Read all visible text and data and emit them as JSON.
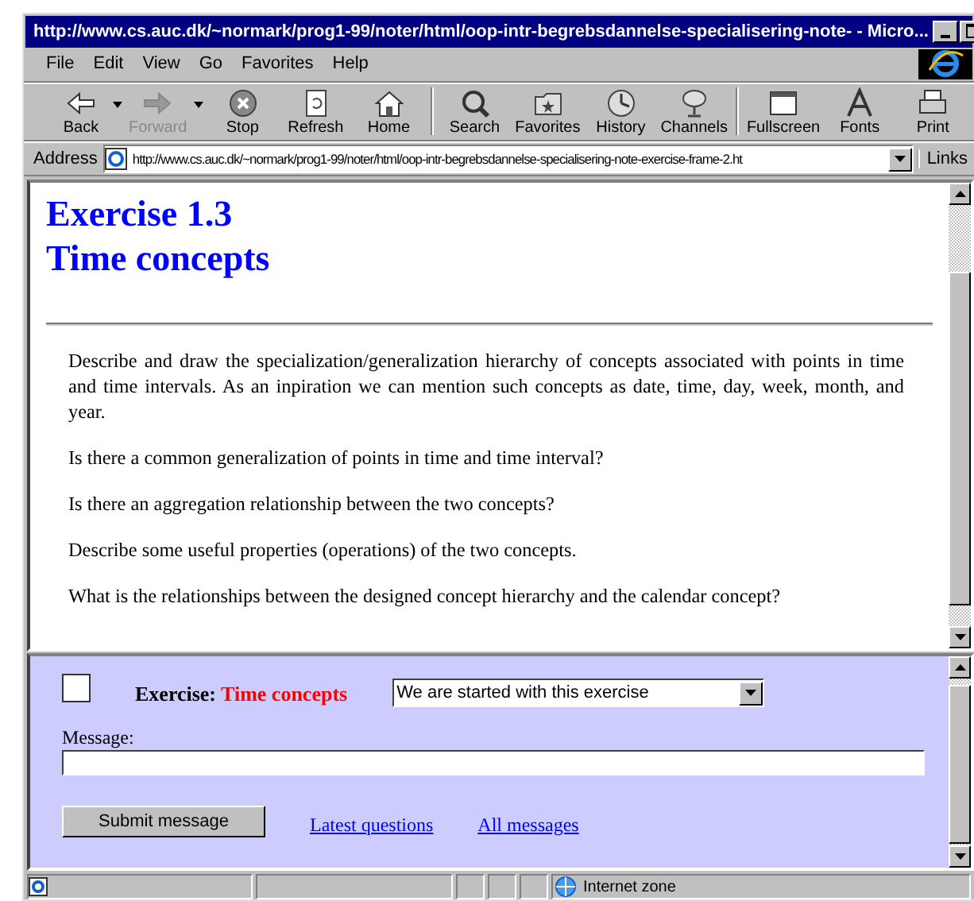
{
  "window": {
    "title": "http://www.cs.auc.dk/~normark/prog1-99/noter/html/oop-intr-begrebsdannelse-specialisering-note- - Micro..."
  },
  "menu": [
    "File",
    "Edit",
    "View",
    "Go",
    "Favorites",
    "Help"
  ],
  "toolbar": [
    {
      "label": "Back",
      "kind": "back",
      "disabled": false,
      "dropdown": true
    },
    {
      "label": "Forward",
      "kind": "forward",
      "disabled": true,
      "dropdown": true
    },
    {
      "label": "Stop",
      "kind": "stop",
      "disabled": false,
      "dropdown": false
    },
    {
      "label": "Refresh",
      "kind": "refresh",
      "disabled": false,
      "dropdown": false
    },
    {
      "label": "Home",
      "kind": "home",
      "disabled": false,
      "dropdown": false
    },
    {
      "label": "Search",
      "kind": "search",
      "disabled": false,
      "dropdown": false
    },
    {
      "label": "Favorites",
      "kind": "favorites",
      "disabled": false,
      "dropdown": false
    },
    {
      "label": "History",
      "kind": "history",
      "disabled": false,
      "dropdown": false
    },
    {
      "label": "Channels",
      "kind": "channels",
      "disabled": false,
      "dropdown": false
    },
    {
      "label": "Fullscreen",
      "kind": "fullscreen",
      "disabled": false,
      "dropdown": false
    },
    {
      "label": "Fonts",
      "kind": "fonts",
      "disabled": false,
      "dropdown": false
    },
    {
      "label": "Print",
      "kind": "print",
      "disabled": false,
      "dropdown": false
    }
  ],
  "address": {
    "label": "Address",
    "value": "http://www.cs.auc.dk/~normark/prog1-99/noter/html/oop-intr-begrebsdannelse-specialisering-note-exercise-frame-2.ht"
  },
  "links": "Links",
  "content": {
    "heading": [
      "Exercise 1.3",
      "Time concepts"
    ],
    "paragraphs": [
      "Describe and draw the specialization/generalization hierarchy of concepts associated with points in time and time intervals. As an inpiration we can mention such concepts as date, time, day, week, month, and year.",
      "Is there a common generalization of points in time and time interval?",
      "Is there an aggregation relationship between the two concepts?",
      "Describe some useful properties (operations) of the two concepts.",
      "What is the relationships between the designed concept hierarchy and the calendar concept?"
    ]
  },
  "form": {
    "checked": false,
    "exercise_label": "Exercise:",
    "exercise_title": "Time concepts",
    "status_select": "We are started with this exercise",
    "message_label": "Message:",
    "submit": "Submit message",
    "links": [
      "Latest questions",
      "All messages"
    ]
  },
  "status_bar": {
    "zone": "Internet zone"
  }
}
